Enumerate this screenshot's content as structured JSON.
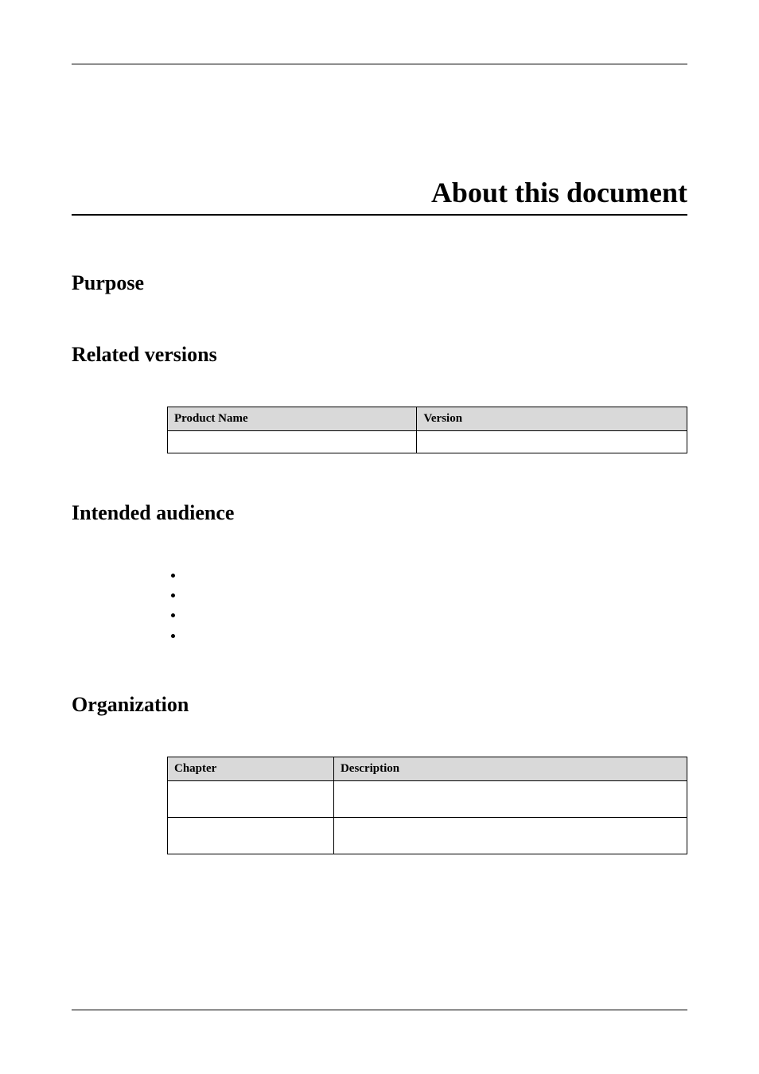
{
  "title": "About this document",
  "sections": {
    "purpose": {
      "heading": "Purpose"
    },
    "related_versions": {
      "heading": "Related versions",
      "table": {
        "col1": "Product Name",
        "col2": "Version",
        "row1": {
          "name": "",
          "version": ""
        }
      }
    },
    "intended_audience": {
      "heading": "Intended audience",
      "bullets": [
        "",
        "",
        "",
        ""
      ]
    },
    "organization": {
      "heading": "Organization",
      "table": {
        "col1": "Chapter",
        "col2": "Description",
        "rows": [
          {
            "chapter": "",
            "description": ""
          },
          {
            "chapter": "",
            "description": ""
          }
        ]
      }
    }
  }
}
